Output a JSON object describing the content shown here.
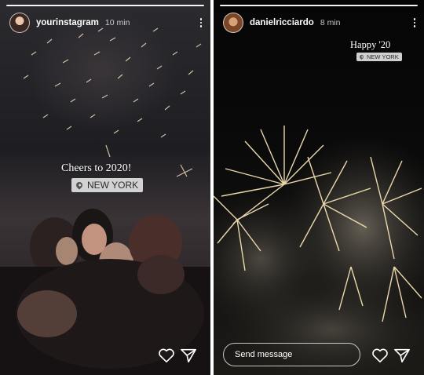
{
  "stories": [
    {
      "username": "yourinstagram",
      "time": "10 min",
      "caption": "Cheers to 2020!",
      "location": "NEW YORK"
    },
    {
      "username": "danielricciardo",
      "time": "8 min",
      "caption": "Happy '20",
      "location": "NEW YORK",
      "message_placeholder": "Send message"
    }
  ],
  "icons": {
    "more": "more-vertical-icon",
    "like": "heart-icon",
    "share": "send-icon",
    "location": "location-pin-icon"
  }
}
